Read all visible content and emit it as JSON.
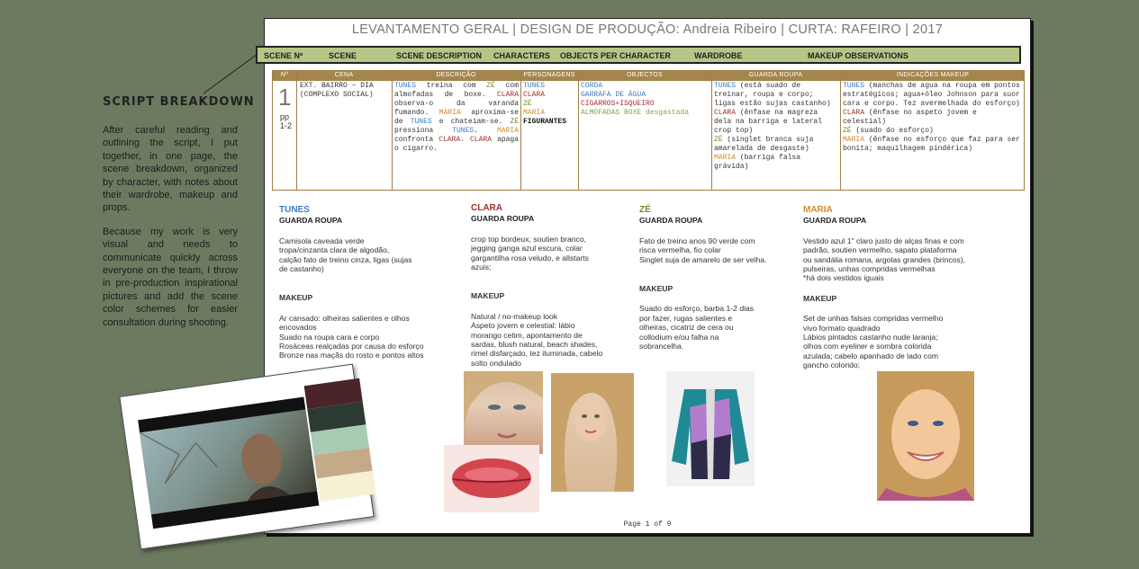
{
  "side": {
    "title": "SCRIPT BREAKDOWN",
    "p1": "After careful reading and outlining  the script, I put together, in one page, the scene breakdown, organized  by character, with notes about their wardrobe, makeup and props.",
    "p2": "Because my work is very visual and needs to communicate quickly across everyone on the team, I throw in pre-production inspirational pictures and add the scene color schemes for easier consultation during shooting."
  },
  "sheet": {
    "title": "LEVANTAMENTO GERAL | DESIGN DE PRODUÇÃO: Andreia Ribeiro | CURTA: RAFEIRO | 2017",
    "footer": "Page 1 of 9"
  },
  "header_bar": [
    "SCENE Nº",
    "SCENE",
    "SCENE DESCRIPTION",
    "CHARACTERS",
    "OBJECTS PER CHARACTER",
    "WARDROBE",
    "MAKEUP OBSERVATIONS"
  ],
  "table": {
    "headers": [
      "Nº",
      "CENA",
      "DESCRIÇÃO",
      "PERSONAGENS",
      "OBJECTOS",
      "GUARDA ROUPA",
      "INDICAÇÕES MAKEUP"
    ],
    "scene_number": "1",
    "pages": "pp\n1-2",
    "cena": "EXT. BAIRRO – DIA (COMPLEXO SOCIAL)",
    "personagens": [
      "TUNES",
      "CLARA",
      "ZÉ",
      "MARIA",
      "FIGURANTES"
    ],
    "objectos": [
      "CORDA",
      "GARRAFA DE ÁGUA",
      "CIGARROS+ISQUEIRO",
      "ALMOFADAS BOXE desgastada"
    ]
  },
  "characters": {
    "tunes": {
      "name": "TUNES",
      "wardrobe_label": "GUARDA ROUPA",
      "wardrobe": "Camisola caveada verde\ntropa/cinzanta clara de algodão,\ncalção fato de treino cinza, ligas (sujas\nde castanho)",
      "makeup_label": "MAKEUP",
      "makeup": "Ar cansado: olheiras salientes e olhos\nencovados\nSuado na roupa cara e corpo\nRosáceas realçadas por causa do esforço\nBronze nas maçãs do rosto e pontos altos"
    },
    "clara": {
      "name": "CLARA",
      "wardrobe_label": "GUARDA ROUPA",
      "wardrobe": "crop top bordeux, soutien branco,\njegging ganga azul escura, colar\ngargantilha rosa veludo, e allstarts\nazuis;",
      "makeup_label": "MAKEUP",
      "makeup": "Natural / no-makeup look\nAspeto jovem e celestial: lábio\nmorango cetim, apontamento de\nsardas, blush natural, beach shades,\nrimel disfarçado, tez iluminada, cabelo\nsolto ondulado"
    },
    "ze": {
      "name": "ZÉ",
      "wardrobe_label": "GUARDA ROUPA",
      "wardrobe": "Fato de treino anos 90 verde com\nrisca vermelha, fio colar\nSinglet suja de amarelo de ser velha.",
      "makeup_label": "MAKEUP",
      "makeup": "Suado do esforço, barba 1-2 dias\npor fazer, rugas salientes e\nolheiras, cicatriz de cera ou\ncollodium e/ou falha na\nsobrancelha."
    },
    "maria": {
      "name": "MARIA",
      "wardrobe_label": "GUARDA ROUPA",
      "wardrobe": "Vestido azul 1\" claro justo de alças finas e com\npadrão, soutien vermelho, sapato plataforma\nou sandália romana, argolas grandes (brincos),\npulseiras, unhas compridas vermelhas\n*há dois vestidos iguais",
      "makeup_label": "MAKEUP",
      "makeup": "Set de unhas falsas compridas vermelho\nvivo formato quadrado\nLábios pintados castanho nude laranja;\nolhos com eyeliner e sombra colorida\nazulada; cabelo apanhado de lado com\ngancho colorido;"
    }
  },
  "colors": {
    "tunes": "#3d7cc4",
    "clara": "#a0302e",
    "ze": "#6f8a2e",
    "maria": "#d28a2c",
    "header_bar": "#b5c787",
    "table_header": "#a4864d",
    "swatches": [
      "#4a2426",
      "#2d3a31",
      "#a9cbb3",
      "#c5aa88",
      "#f6f1d4"
    ]
  }
}
